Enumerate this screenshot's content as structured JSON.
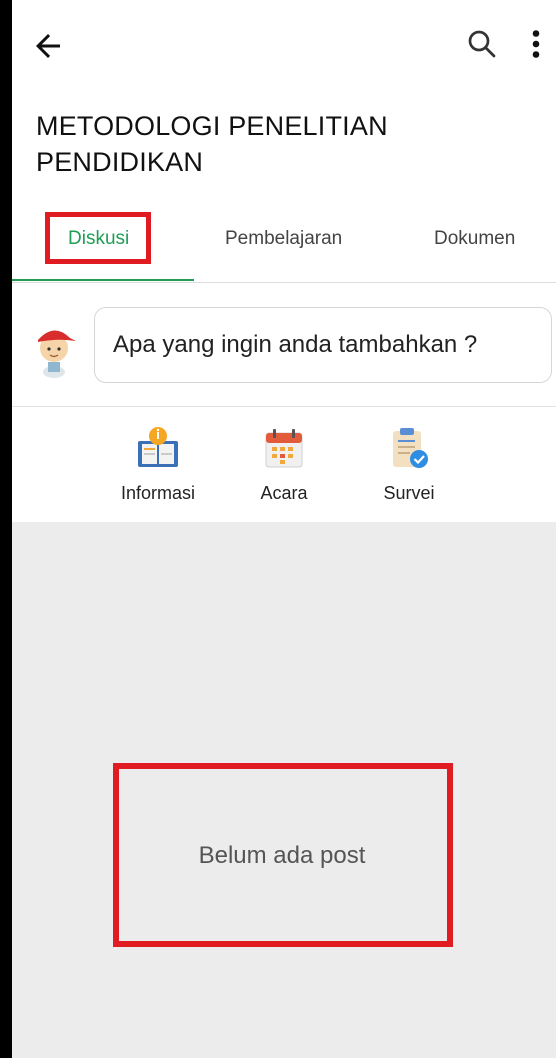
{
  "header": {
    "title": "METODOLOGI PENELITIAN PENDIDIKAN",
    "icons": [
      "back-arrow-icon",
      "search-icon",
      "more-vert-icon"
    ]
  },
  "tabs": [
    {
      "label": "Diskusi",
      "active": true
    },
    {
      "label": "Pembelajaran",
      "active": false
    },
    {
      "label": "Dokumen",
      "active": false
    }
  ],
  "composer": {
    "placeholder": "Apa yang ingin anda tambahkan ?"
  },
  "actions": [
    {
      "label": "Informasi",
      "icon": "info-book-icon"
    },
    {
      "label": "Acara",
      "icon": "calendar-icon"
    },
    {
      "label": "Survei",
      "icon": "survey-clipboard-icon"
    }
  ],
  "feed": {
    "empty_message": "Belum ada post"
  },
  "colors": {
    "accent": "#1f9d55",
    "highlight": "#e01b22",
    "feed_bg": "#ececec"
  }
}
